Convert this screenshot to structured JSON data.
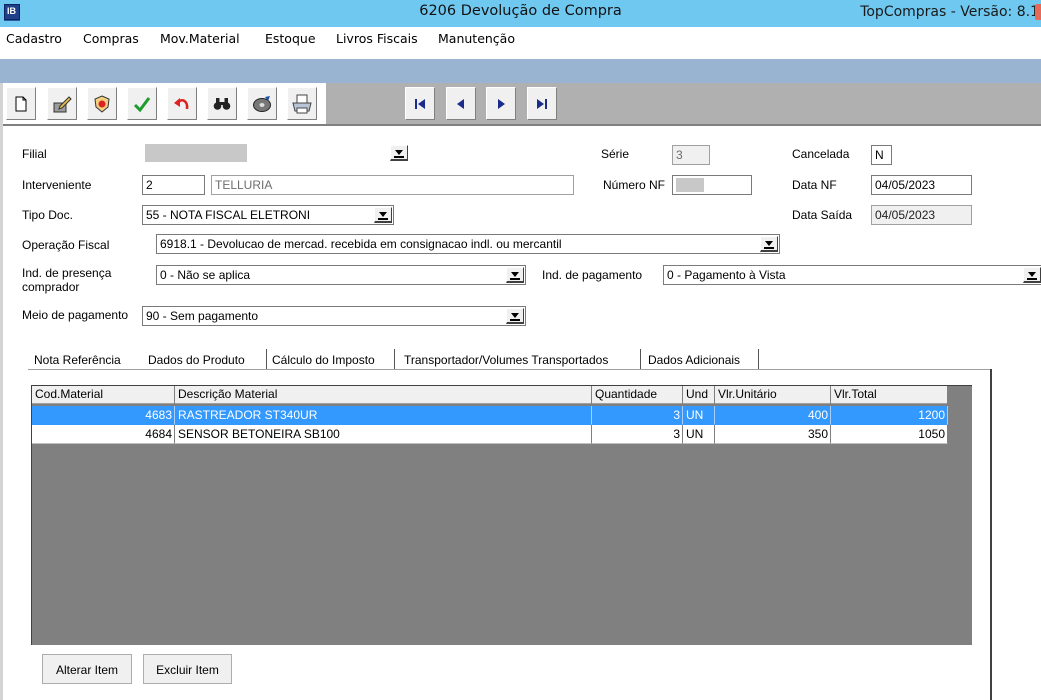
{
  "app": {
    "title": "TopCompras - Versão: 8.1"
  },
  "menu": [
    {
      "label": "Cadastro"
    },
    {
      "label": "Compras"
    },
    {
      "label": "Mov.Material"
    },
    {
      "label": "Estoque"
    },
    {
      "label": "Livros Fiscais"
    },
    {
      "label": "Manutenção"
    }
  ],
  "window": {
    "title": "6206 Devolução de Compra",
    "icon_text": "IB"
  },
  "toolbar": {
    "icons": [
      "new-document-icon",
      "edit-pencil-icon",
      "delete-icon",
      "confirm-check-icon",
      "undo-arrow-icon",
      "search-binoculars-icon",
      "disk-icon",
      "print-icon",
      "first-record-icon",
      "previous-record-icon",
      "next-record-icon",
      "last-record-icon"
    ]
  },
  "form": {
    "filial": {
      "label": "Filial",
      "value": ""
    },
    "serie": {
      "label": "Série",
      "value": "3"
    },
    "cancelada": {
      "label": "Cancelada",
      "value": "N"
    },
    "interveniente": {
      "label": "Interveniente",
      "code": "2",
      "name": "TELLURIA"
    },
    "numero_nf": {
      "label": "Número NF",
      "value": ""
    },
    "data_nf": {
      "label": "Data NF",
      "value": "04/05/2023"
    },
    "tipo_doc": {
      "label": "Tipo Doc.",
      "value": "55 - NOTA FISCAL ELETRONI"
    },
    "data_saida": {
      "label": "Data Saída",
      "value": "04/05/2023"
    },
    "operacao_fiscal": {
      "label": "Operação Fiscal",
      "value": "6918.1 - Devolucao de mercad. recebida em consignacao indl. ou mercantil"
    },
    "ind_presenca": {
      "label_line1": "Ind. de presença",
      "label_line2": "comprador",
      "value": "0 - Não se aplica"
    },
    "ind_pagamento": {
      "label": "Ind. de pagamento",
      "value": "0 - Pagamento à Vista"
    },
    "meio_pagamento": {
      "label": "Meio de pagamento",
      "value": "90 - Sem pagamento"
    }
  },
  "tabs": [
    {
      "label": "Nota Referência",
      "active": false
    },
    {
      "label": "Dados do Produto",
      "active": true
    },
    {
      "label": "Cálculo do Imposto",
      "active": false
    },
    {
      "label": "Transportador/Volumes Transportados",
      "active": false
    },
    {
      "label": "Dados Adicionais",
      "active": false
    }
  ],
  "grid": {
    "columns": [
      "Cod.Material",
      "Descrição Material",
      "Quantidade",
      "Und",
      "Vlr.Unitário",
      "Vlr.Total"
    ],
    "rows": [
      {
        "cod": "4683",
        "desc": "RASTREADOR ST340UR",
        "qtd": "3",
        "und": "UN",
        "unit": "400",
        "total": "1200",
        "selected": true
      },
      {
        "cod": "4684",
        "desc": "SENSOR BETONEIRA SB100",
        "qtd": "3",
        "und": "UN",
        "unit": "350",
        "total": "1050",
        "selected": false
      }
    ]
  },
  "buttons": {
    "alterar": "Alterar Item",
    "excluir": "Excluir Item"
  },
  "colors": {
    "app_title_bar": "#6fc8f0",
    "window_title_bar": "#99b4d1",
    "selection": "#3399ff",
    "grid_background": "#808080"
  }
}
